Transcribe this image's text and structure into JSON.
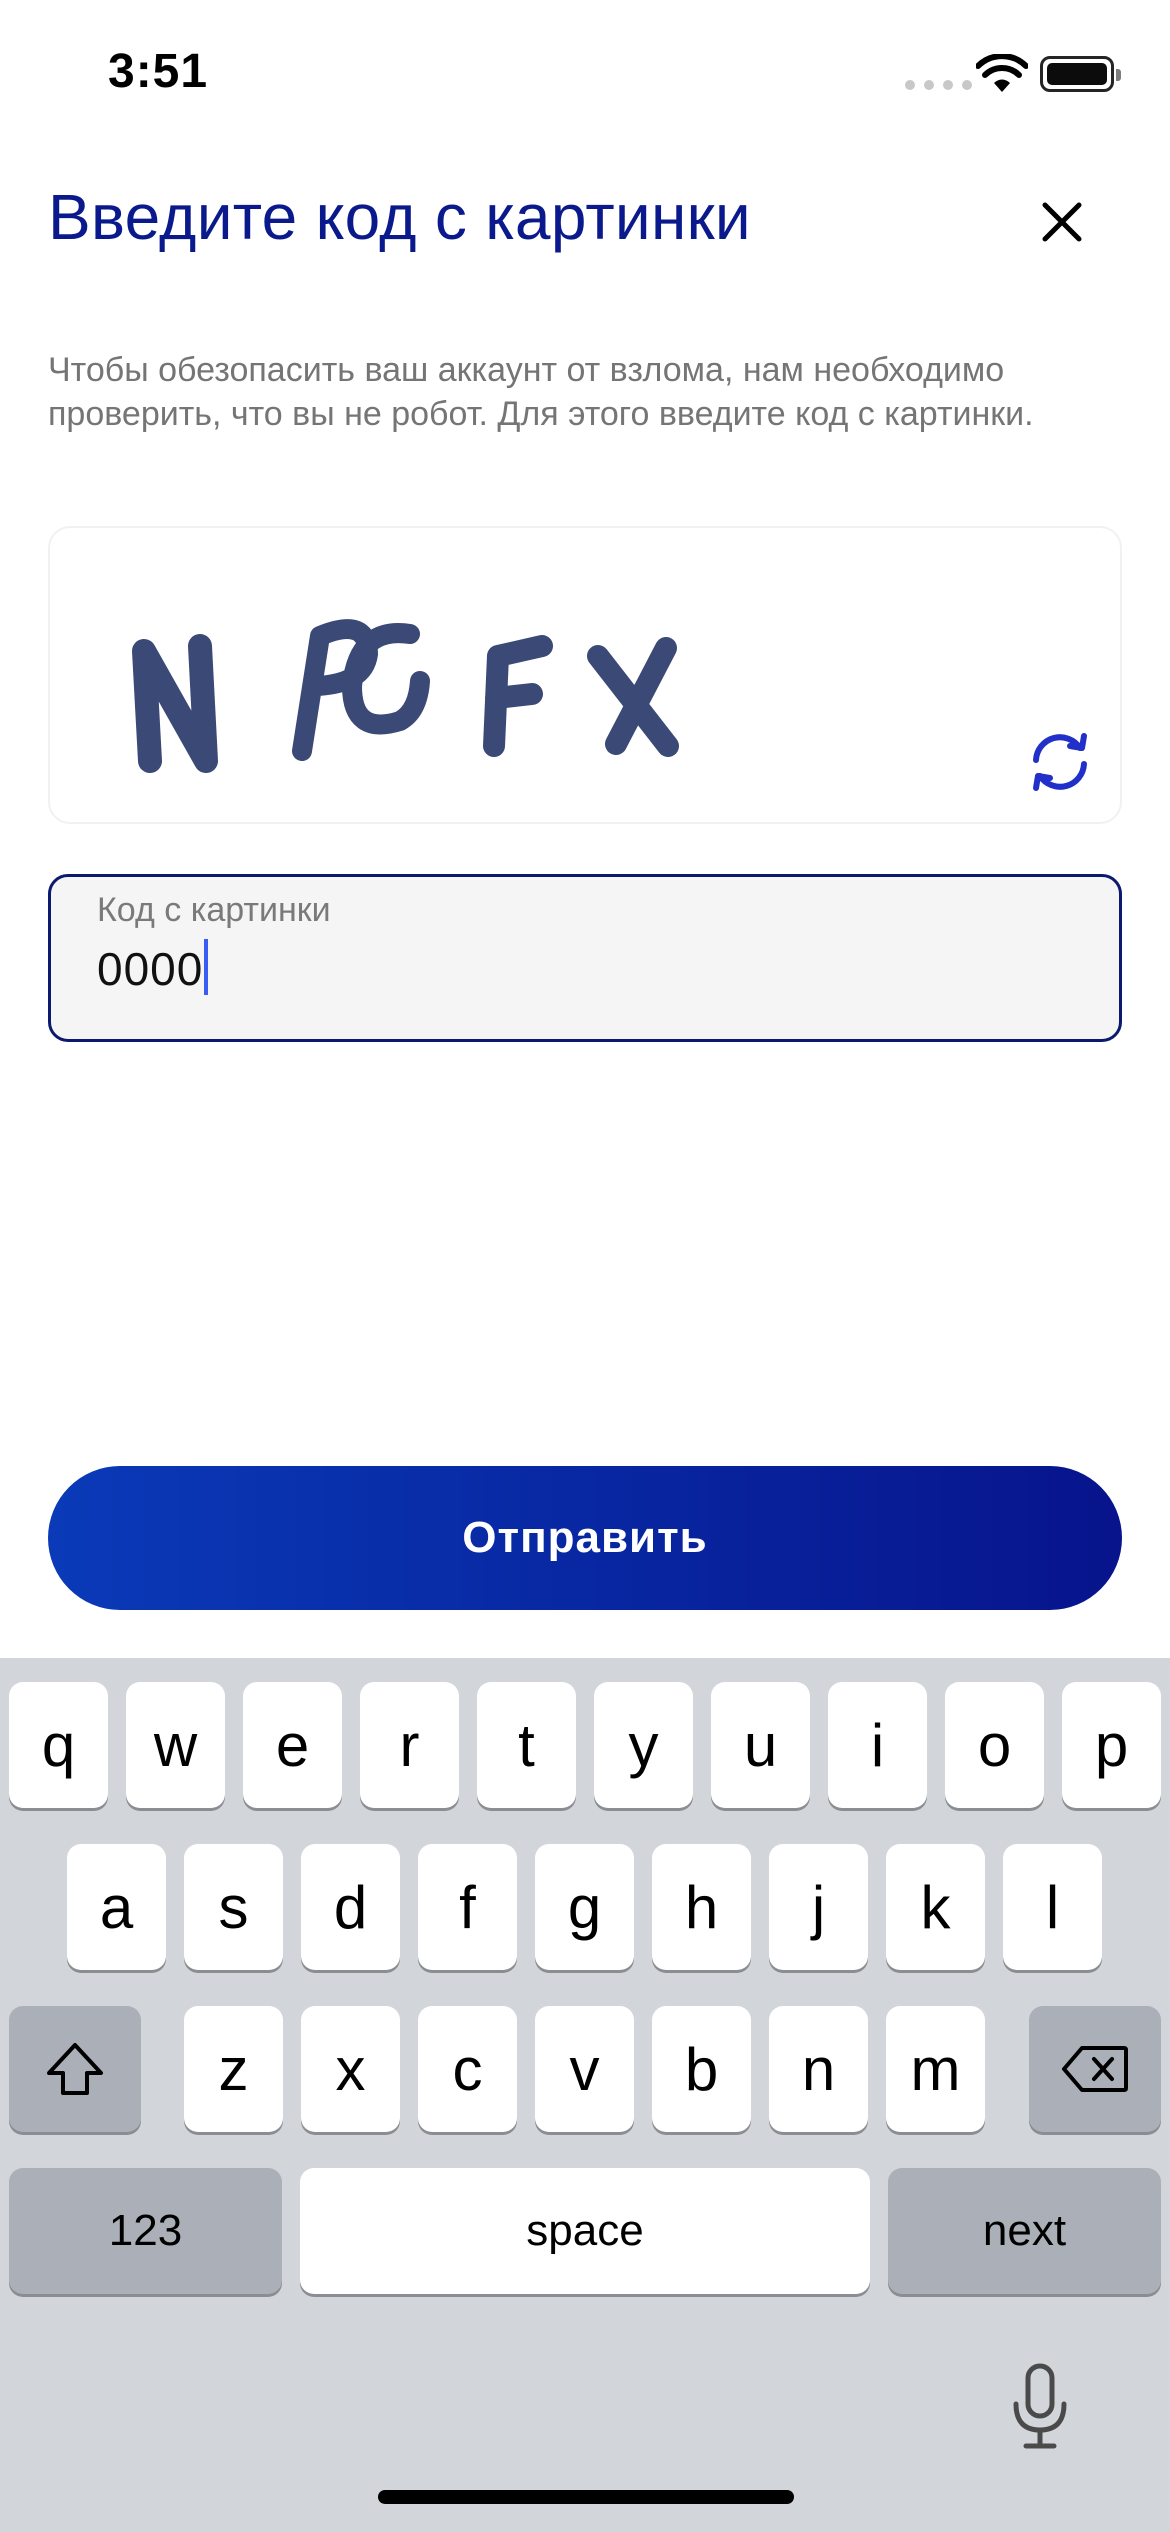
{
  "status_bar": {
    "time": "3:51"
  },
  "header": {
    "title": "Введите код с картинки"
  },
  "description": "Чтобы обезопасить ваш аккаунт от взлома, нам необходимо проверить, что вы не робот. Для этого введите код с картинки.",
  "captcha": {
    "text": "NPCFX"
  },
  "input": {
    "label": "Код с картинки",
    "value": "0000"
  },
  "submit": {
    "label": "Отправить"
  },
  "keyboard": {
    "row1": [
      "q",
      "w",
      "e",
      "r",
      "t",
      "y",
      "u",
      "i",
      "o",
      "p"
    ],
    "row2": [
      "a",
      "s",
      "d",
      "f",
      "g",
      "h",
      "j",
      "k",
      "l"
    ],
    "row3": [
      "z",
      "x",
      "c",
      "v",
      "b",
      "n",
      "m"
    ],
    "numbers_label": "123",
    "space_label": "space",
    "next_label": "next"
  },
  "colors": {
    "accent": "#0a1a8c",
    "button_start": "#0a3ab8",
    "button_end": "#07148c",
    "caret": "#3a5cf5"
  }
}
